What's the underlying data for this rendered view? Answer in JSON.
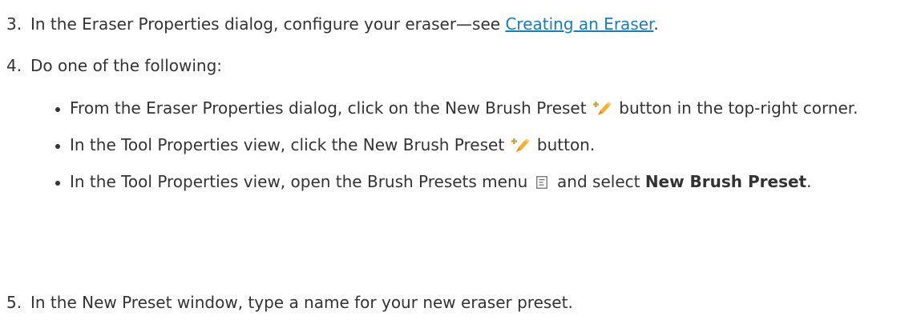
{
  "steps": {
    "step3": {
      "number": "3.",
      "text_before": "In the Eraser Properties dialog, configure your eraser—see ",
      "link": "Creating an Eraser",
      "text_after": "."
    },
    "step4": {
      "number": "4.",
      "text": "Do one of the following:"
    },
    "bullets": {
      "b1": {
        "text_before": "From the Eraser Properties dialog, click on the New Brush Preset",
        "text_after": " button in the top-right corner."
      },
      "b2": {
        "text_before": "In the Tool Properties view, click the New Brush Preset",
        "text_after": " button."
      },
      "b3": {
        "text_before": "In the Tool Properties view, open the Brush Presets menu",
        "text_mid": "and select ",
        "bold": "New Brush Preset",
        "text_after": "."
      }
    },
    "step5": {
      "number": "5.",
      "text": "In the New Preset window, type a name for your new eraser preset."
    }
  },
  "colors": {
    "text": "#333333",
    "link": "#1a7bbf"
  },
  "icons": {
    "new_preset": "new-brush-preset-icon",
    "menu": "brush-presets-menu-icon"
  }
}
